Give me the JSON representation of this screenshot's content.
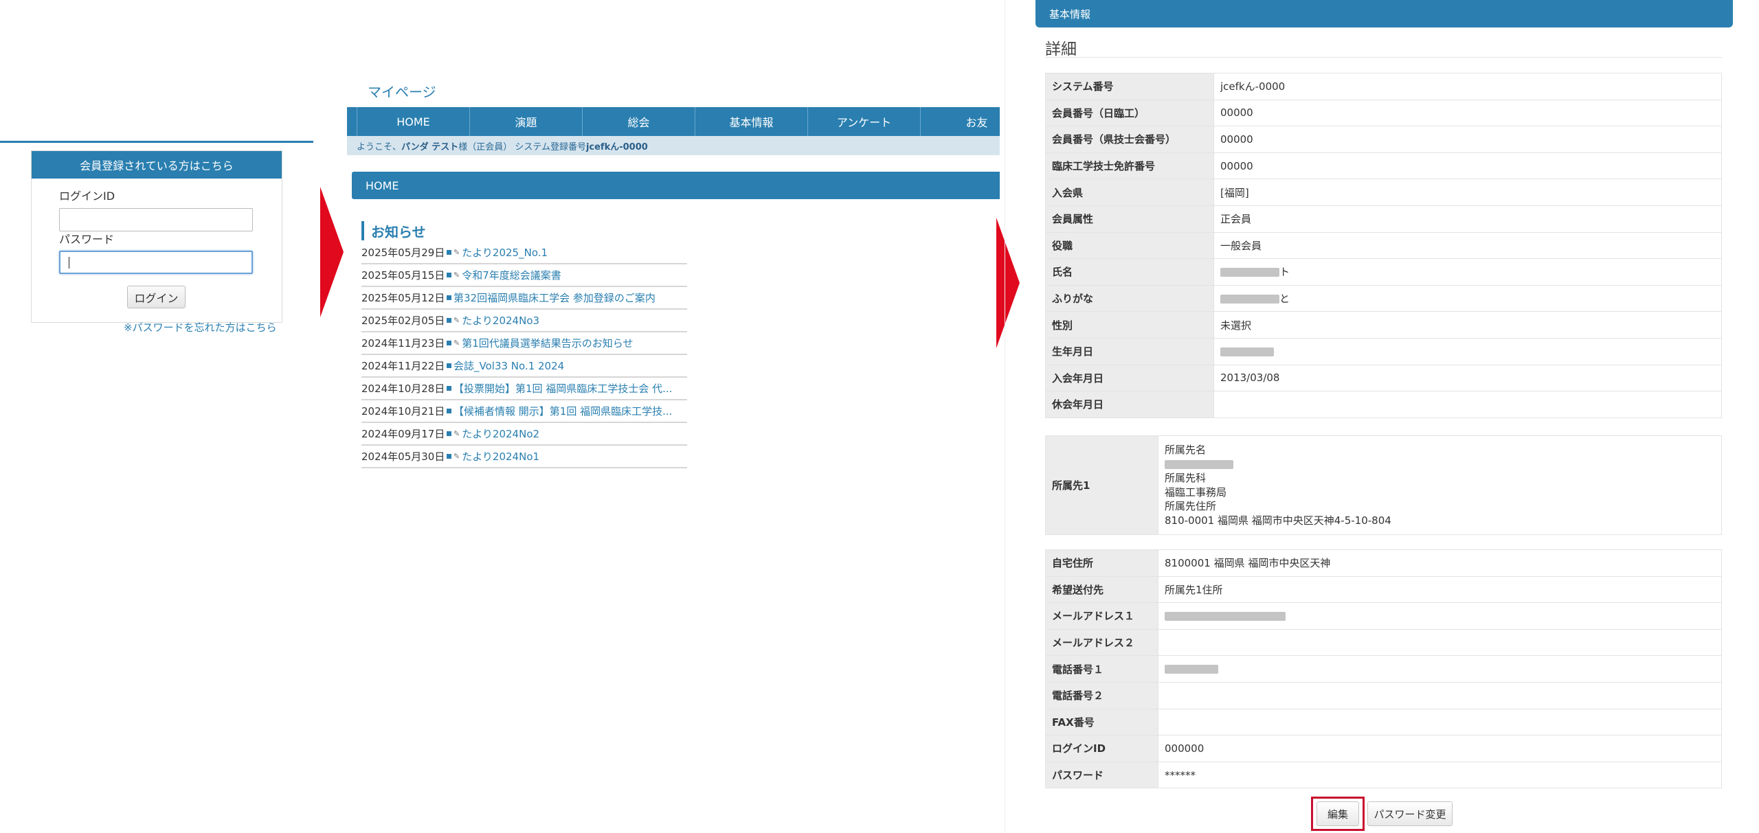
{
  "login": {
    "header": "会員登録されている方はこちら",
    "login_id_label": "ログインID",
    "login_id_value": "",
    "password_label": "パスワード",
    "password_value": "",
    "login_button": "ログイン",
    "forgot_link": "※パスワードを忘れた方はこちら"
  },
  "mypage": {
    "title": "マイページ",
    "nav": [
      "HOME",
      "演題",
      "総会",
      "基本情報",
      "アンケート",
      "お友"
    ],
    "welcome_prefix": "ようこそ、",
    "welcome_name": "パンダ テスト",
    "welcome_suffix": " 様（正会員） システム登録番号 ",
    "welcome_system_no": "jcefkん-0000",
    "home_bar": "HOME",
    "news_heading": "お知らせ",
    "news": [
      {
        "date": "2025年05月29日",
        "title": "たより2025_No.1",
        "attachment": true
      },
      {
        "date": "2025年05月15日",
        "title": "令和7年度総会議案書",
        "attachment": true
      },
      {
        "date": "2025年05月12日",
        "title": "第32回福岡県臨床工学会 参加登録のご案内",
        "attachment": false
      },
      {
        "date": "2025年02月05日",
        "title": "たより2024No3",
        "attachment": true
      },
      {
        "date": "2024年11月23日",
        "title": "第1回代議員選挙結果告示のお知らせ",
        "attachment": true
      },
      {
        "date": "2024年11月22日",
        "title": "会誌_Vol33 No.1 2024",
        "attachment": false
      },
      {
        "date": "2024年10月28日",
        "title": "【投票開始】第1回 福岡県臨床工学技士会 代...",
        "attachment": false
      },
      {
        "date": "2024年10月21日",
        "title": "【候補者情報 開示】第1回 福岡県臨床工学技...",
        "attachment": false
      },
      {
        "date": "2024年09月17日",
        "title": "たより2024No2",
        "attachment": true
      },
      {
        "date": "2024年05月30日",
        "title": "たより2024No1",
        "attachment": true
      }
    ]
  },
  "detail": {
    "bar_title": "基本情報",
    "title": "詳細",
    "rows": [
      {
        "label": "システム番号",
        "value": "jcefkん-0000"
      },
      {
        "label": "会員番号（日臨工）",
        "value": "00000"
      },
      {
        "label": "会員番号（県技士会番号）",
        "value": "00000"
      },
      {
        "label": "臨床工学技士免許番号",
        "value": "00000"
      },
      {
        "label": "入会県",
        "value": "[福岡]"
      },
      {
        "label": "会員属性",
        "value": "正会員"
      },
      {
        "label": "役職",
        "value": "一般会員"
      },
      {
        "label": "氏名",
        "value": "ト"
      },
      {
        "label": "ふりがな",
        "value": "と"
      },
      {
        "label": "性別",
        "value": "未選択"
      },
      {
        "label": "生年月日",
        "value": ""
      },
      {
        "label": "入会年月日",
        "value": "2013/03/08"
      },
      {
        "label": "休会年月日",
        "value": ""
      }
    ],
    "affiliation": {
      "label": "所属先1",
      "name_label": "所属先名",
      "dept_label": "所属先科",
      "dept_value": "福臨工事務局",
      "address_label": "所属先住所",
      "address_value": "810-0001 福岡県 福岡市中央区天神4-5-10-804"
    },
    "contact_rows": [
      {
        "label": "自宅住所",
        "value": "8100001 福岡県 福岡市中央区天神"
      },
      {
        "label": "希望送付先",
        "value": "所属先1住所"
      },
      {
        "label": "メールアドレス１",
        "value": ""
      },
      {
        "label": "メールアドレス２",
        "value": ""
      },
      {
        "label": "電話番号１",
        "value": ""
      },
      {
        "label": "電話番号２",
        "value": ""
      },
      {
        "label": "FAX番号",
        "value": ""
      },
      {
        "label": "ログインID",
        "value": "000000"
      },
      {
        "label": "パスワード",
        "value": "******"
      }
    ],
    "edit_button": "編集",
    "change_password_button": "パスワード変更"
  },
  "colors": {
    "accent": "#2a7fb0",
    "arrow": "#e0091d",
    "highlight": "#c8102e"
  }
}
